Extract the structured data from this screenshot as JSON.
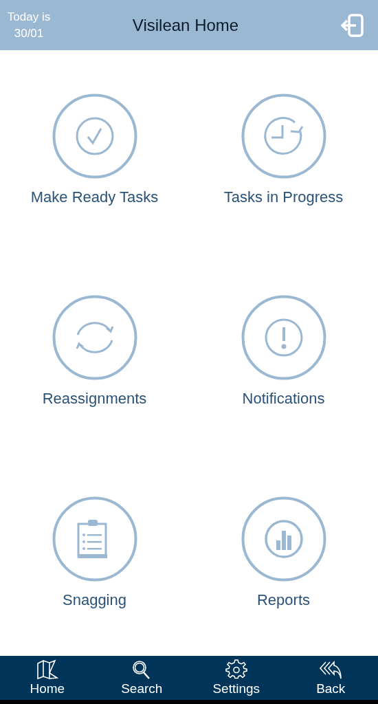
{
  "header": {
    "date_label": "Today is",
    "date": "30/01",
    "title": "Visilean Home"
  },
  "tiles": [
    {
      "label": "Make Ready Tasks",
      "kind": "check"
    },
    {
      "label": "Tasks in Progress",
      "kind": "clock"
    },
    {
      "label": "Reassignments",
      "kind": "cycle"
    },
    {
      "label": "Notifications",
      "kind": "alert"
    },
    {
      "label": "Snagging",
      "kind": "clipboard"
    },
    {
      "label": "Reports",
      "kind": "chart"
    }
  ],
  "nav": [
    {
      "label": "Home",
      "kind": "map"
    },
    {
      "label": "Search",
      "kind": "search"
    },
    {
      "label": "Settings",
      "kind": "gear"
    },
    {
      "label": "Back",
      "kind": "back"
    }
  ]
}
